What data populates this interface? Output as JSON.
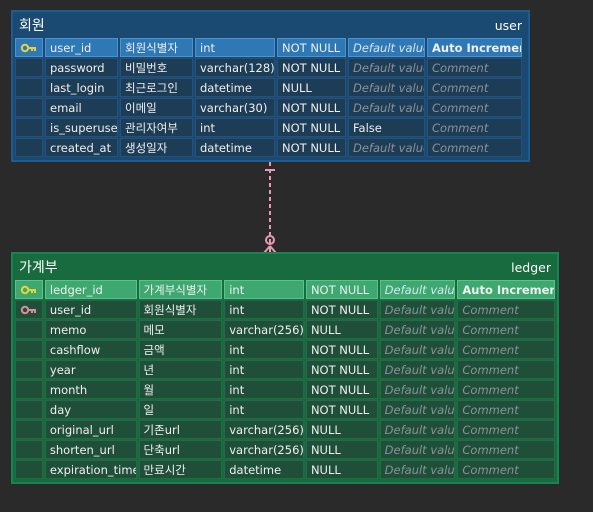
{
  "tables": {
    "user": {
      "name": "회원",
      "alias": "user",
      "rows": [
        {
          "key": "pk",
          "field": "user_id",
          "label": "회원식별자",
          "type": "int",
          "null": "NOT NULL",
          "default": "Default value",
          "extra": "Auto Increment"
        },
        {
          "key": "",
          "field": "password",
          "label": "비밀번호",
          "type": "varchar(128)",
          "null": "NOT NULL",
          "default": "Default value",
          "extra": "Comment"
        },
        {
          "key": "",
          "field": "last_login",
          "label": "최근로그인",
          "type": "datetime",
          "null": "NULL",
          "default": "Default value",
          "extra": "Comment"
        },
        {
          "key": "",
          "field": "email",
          "label": "이메일",
          "type": "varchar(30)",
          "null": "NOT NULL",
          "default": "Default value",
          "extra": "Comment"
        },
        {
          "key": "",
          "field": "is_superuser",
          "label": "관리자여부",
          "type": "int",
          "null": "NOT NULL",
          "default": "False",
          "extra": "Comment"
        },
        {
          "key": "",
          "field": "created_at",
          "label": "생성일자",
          "type": "datetime",
          "null": "NOT NULL",
          "default": "Default value",
          "extra": "Comment"
        }
      ]
    },
    "ledger": {
      "name": "가계부",
      "alias": "ledger",
      "rows": [
        {
          "key": "pk",
          "field": "ledger_id",
          "label": "가계부식별자",
          "type": "int",
          "null": "NOT NULL",
          "default": "Default value",
          "extra": "Auto Increment"
        },
        {
          "key": "fk",
          "field": "user_id",
          "label": "회원식별자",
          "type": "int",
          "null": "NOT NULL",
          "default": "Default value",
          "extra": "Comment"
        },
        {
          "key": "",
          "field": "memo",
          "label": "메모",
          "type": "varchar(256)",
          "null": "NULL",
          "default": "Default value",
          "extra": "Comment"
        },
        {
          "key": "",
          "field": "cashflow",
          "label": "금액",
          "type": "int",
          "null": "NOT NULL",
          "default": "Default value",
          "extra": "Comment"
        },
        {
          "key": "",
          "field": "year",
          "label": "년",
          "type": "int",
          "null": "NOT NULL",
          "default": "Default value",
          "extra": "Comment"
        },
        {
          "key": "",
          "field": "month",
          "label": "월",
          "type": "int",
          "null": "NOT NULL",
          "default": "Default value",
          "extra": "Comment"
        },
        {
          "key": "",
          "field": "day",
          "label": "일",
          "type": "int",
          "null": "NOT NULL",
          "default": "Default value",
          "extra": "Comment"
        },
        {
          "key": "",
          "field": "original_url",
          "label": "기존url",
          "type": "varchar(256)",
          "null": "NULL",
          "default": "Default value",
          "extra": "Comment"
        },
        {
          "key": "",
          "field": "shorten_url",
          "label": "단축url",
          "type": "varchar(256)",
          "null": "NULL",
          "default": "Default value",
          "extra": "Comment"
        },
        {
          "key": "",
          "field": "expiration_time",
          "label": "만료시간",
          "type": "datetime",
          "null": "NULL",
          "default": "Default value",
          "extra": "Comment"
        }
      ]
    }
  },
  "icons": {
    "pk": "primary-key-icon",
    "fk": "foreign-key-icon"
  },
  "colors": {
    "pk_key": "#e8d23c",
    "fk_key": "#e08aa0",
    "relation_line": "#e89ab0",
    "user_header": "#1a4a72",
    "ledger_header": "#176b3f"
  },
  "placeholders": [
    "Default value",
    "Comment"
  ]
}
